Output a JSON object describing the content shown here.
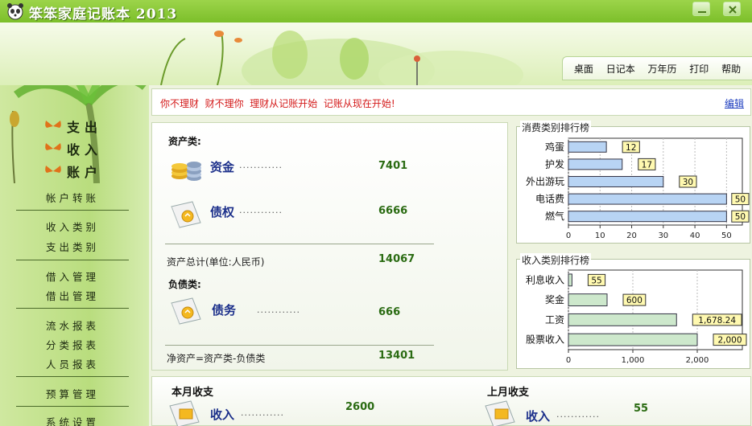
{
  "app": {
    "title": "笨笨家庭记账本 2013"
  },
  "colors": {
    "accent": "#8cc63f",
    "slogan": "#d41a1a",
    "value": "#2a6b12",
    "link": "#1f3fbf",
    "expense_bar": "#b8d4f4",
    "income_bar": "#cde8cc"
  },
  "menu": {
    "items": [
      "桌面",
      "日记本",
      "万年历",
      "打印",
      "帮助"
    ]
  },
  "sidebar": {
    "main": [
      "支出",
      "收入",
      "账户"
    ],
    "items": [
      "帐户转账",
      "收入类别",
      "支出类别",
      "借入管理",
      "借出管理",
      "流水报表",
      "分类报表",
      "人员报表",
      "预算管理",
      "系统设置"
    ]
  },
  "slogan": {
    "text": "你不理财  财不理你  理财从记账开始  记账从现在开始!",
    "edit": "编辑"
  },
  "assets": {
    "section_title": "资产类:",
    "items": [
      {
        "name": "资金",
        "dots": "............",
        "value": "7401",
        "icon": "coins-icon"
      },
      {
        "name": "债权",
        "dots": "............",
        "value": "6666",
        "icon": "ledger-icon"
      }
    ],
    "total_label": "资产总计(单位:人民币)",
    "total_value": "14067",
    "liab_title": "负债类:",
    "liab_item": {
      "name": "债务",
      "dots": "............",
      "value": "666",
      "icon": "ledger-icon"
    },
    "net_label": "净资产=资产类-负债类",
    "net_value": "13401"
  },
  "chart_data": [
    {
      "type": "bar",
      "orientation": "horizontal",
      "title": "消费类别排行榜",
      "categories": [
        "鸡蛋",
        "护发",
        "外出游玩",
        "电话费",
        "燃气"
      ],
      "values": [
        12,
        17,
        30,
        50,
        50
      ],
      "data_labels": [
        "12",
        "17",
        "30",
        "50",
        "50"
      ],
      "xlim": [
        0,
        55
      ],
      "xticks": [
        0,
        10,
        20,
        30,
        40,
        50
      ],
      "grid": true,
      "bar_color": "#b8d4f4"
    },
    {
      "type": "bar",
      "orientation": "horizontal",
      "title": "收入类别排行榜",
      "categories": [
        "利息收入",
        "奖金",
        "工资",
        "股票收入"
      ],
      "values": [
        55,
        600,
        1678.24,
        2000
      ],
      "data_labels": [
        "55",
        "600",
        "1,678.24",
        "2,000"
      ],
      "xlim": [
        0,
        2700
      ],
      "xticks": [
        0,
        1000,
        2000
      ],
      "xtick_labels": [
        "0",
        "1,000",
        "2,000"
      ],
      "grid": true,
      "bar_color": "#cde8cc"
    }
  ],
  "monthly": {
    "this_month": {
      "title": "本月收支",
      "label": "收入",
      "dots": "............",
      "value": "2600"
    },
    "last_month": {
      "title": "上月收支",
      "label": "收入",
      "dots": "............",
      "value": "55"
    }
  }
}
